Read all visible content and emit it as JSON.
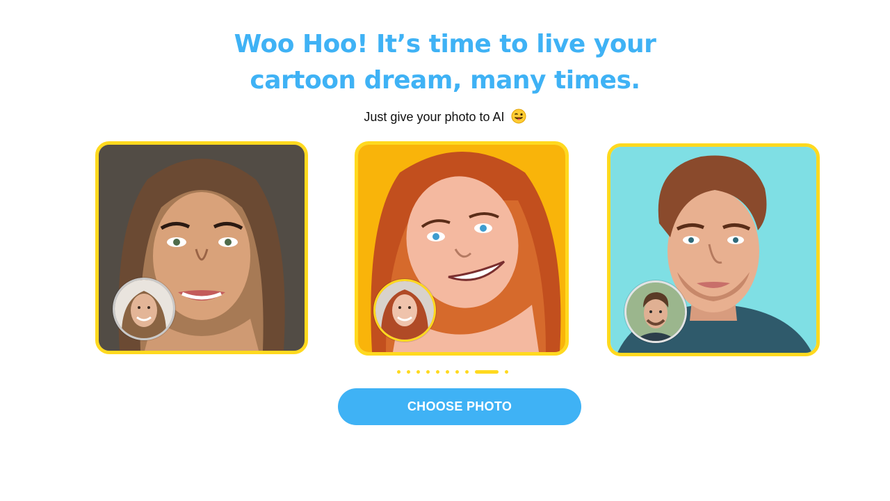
{
  "header": {
    "headline_line1": "Woo Hoo! It’s time to live your",
    "headline_line2": "cartoon dream, many times.",
    "subtitle": "Just give your photo to AI",
    "subtitle_emoji": "winking-tongue-emoji"
  },
  "carousel": {
    "slides": [
      {
        "art": "cartoon-woman-brown-hair",
        "avatar": "original-photo-woman-1"
      },
      {
        "art": "cartoon-woman-red-hair",
        "avatar": "original-photo-woman-2"
      },
      {
        "art": "cartoon-man-brown-hair",
        "avatar": "original-photo-man"
      }
    ],
    "dot_count": 10,
    "active_dot": 8
  },
  "cta": {
    "label": "CHOOSE PHOTO"
  },
  "colors": {
    "accent": "#3fb2f5",
    "card_border": "#ffd91f",
    "dots": "#ffd91f",
    "card2_bg": "#f9b40a",
    "card3_bg": "#7fdfe4"
  }
}
